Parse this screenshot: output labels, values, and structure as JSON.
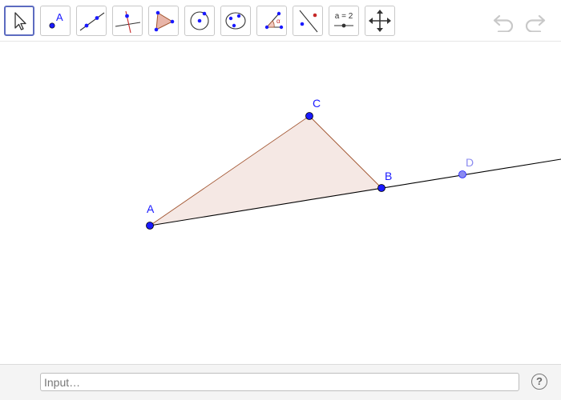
{
  "toolbar": {
    "tools": [
      {
        "name": "move-tool",
        "icon": "arrow-pointer-icon",
        "active": true
      },
      {
        "name": "point-tool",
        "icon": "point-icon",
        "glyph": "A"
      },
      {
        "name": "line-tool",
        "icon": "line-through-points-icon"
      },
      {
        "name": "perpendicular-line-tool",
        "icon": "perpendicular-line-icon"
      },
      {
        "name": "polygon-tool",
        "icon": "polygon-icon"
      },
      {
        "name": "circle-tool",
        "icon": "circle-center-point-icon"
      },
      {
        "name": "conic-tool",
        "icon": "conic-through-points-icon"
      },
      {
        "name": "angle-tool",
        "icon": "angle-icon",
        "glyph": "α"
      },
      {
        "name": "reflect-tool",
        "icon": "reflect-about-line-icon"
      },
      {
        "name": "slider-tool",
        "icon": "slider-icon",
        "glyph": "a = 2"
      },
      {
        "name": "move-graphics-view-tool",
        "icon": "move-arrows-icon"
      }
    ],
    "undo_icon": "undo-icon",
    "redo_icon": "redo-icon"
  },
  "construction": {
    "points": {
      "A": {
        "label": "A"
      },
      "B": {
        "label": "B"
      },
      "C": {
        "label": "C"
      },
      "D": {
        "label": "D"
      }
    },
    "colors": {
      "point": "#1a1aff",
      "point_free_light": "#8b8bf0",
      "triangle_fill": "#f5e8e4",
      "triangle_edge": "#a0522d",
      "line": "#000000"
    }
  },
  "input_bar": {
    "placeholder": "Input…",
    "help_glyph": "?",
    "help_icon": "help-icon"
  }
}
